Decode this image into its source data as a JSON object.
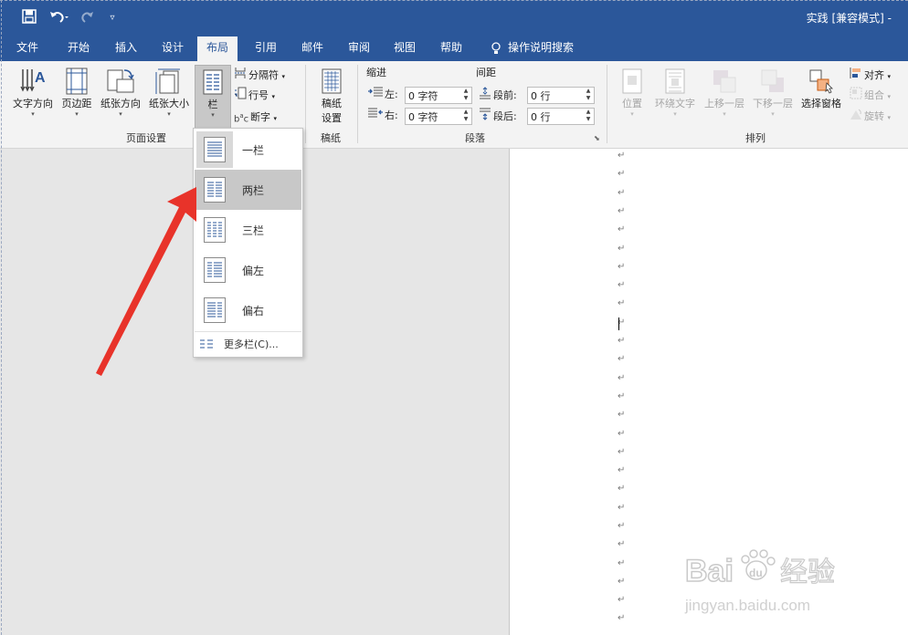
{
  "window": {
    "title": "实践 [兼容模式]",
    "title_suffix": "-"
  },
  "quick_access": [
    "save-icon",
    "undo-icon",
    "redo-icon",
    "customize-icon"
  ],
  "tabs": [
    {
      "label": "文件"
    },
    {
      "label": "开始"
    },
    {
      "label": "插入"
    },
    {
      "label": "设计"
    },
    {
      "label": "布局",
      "active": true
    },
    {
      "label": "引用"
    },
    {
      "label": "邮件"
    },
    {
      "label": "审阅"
    },
    {
      "label": "视图"
    },
    {
      "label": "帮助"
    }
  ],
  "tell_me": "操作说明搜索",
  "ribbon": {
    "page_setup": {
      "text_direction": "文字方向",
      "margins": "页边距",
      "orientation": "纸张方向",
      "size": "纸张大小",
      "columns": "栏",
      "breaks": "分隔符",
      "line_numbers": "行号",
      "hyphenation": "断字",
      "group_label": "页面设置"
    },
    "draft": {
      "button": "稿纸",
      "button2": "设置",
      "group_label": "稿纸"
    },
    "paragraph": {
      "indent": "缩进",
      "spacing": "间距",
      "left_label": "左:",
      "left_value": "0 字符",
      "right_label": "右:",
      "right_value": "0 字符",
      "before_label": "段前:",
      "before_value": "0 行",
      "after_label": "段后:",
      "after_value": "0 行",
      "group_label": "段落"
    },
    "arrange": {
      "position": "位置",
      "wrap_text": "环绕文字",
      "bring_forward": "上移一层",
      "send_backward": "下移一层",
      "selection_pane": "选择窗格",
      "align": "对齐",
      "group": "组合",
      "rotate": "旋转",
      "group_label": "排列"
    }
  },
  "columns_menu": {
    "items": [
      {
        "label": "一栏",
        "cols": 1
      },
      {
        "label": "两栏",
        "cols": 2,
        "highlighted": true
      },
      {
        "label": "三栏",
        "cols": 3
      },
      {
        "label": "偏左",
        "cols": "left"
      },
      {
        "label": "偏右",
        "cols": "right"
      }
    ],
    "more": "更多栏(C)..."
  },
  "document": {
    "paragraph_mark": "↵"
  },
  "watermark": {
    "brand": "Bai",
    "brand2": "du",
    "brand3": "经验",
    "url": "jingyan.baidu.com"
  },
  "colors": {
    "accent": "#2b579a",
    "arrow": "#e8332a",
    "highlight": "#c8c8c8"
  }
}
